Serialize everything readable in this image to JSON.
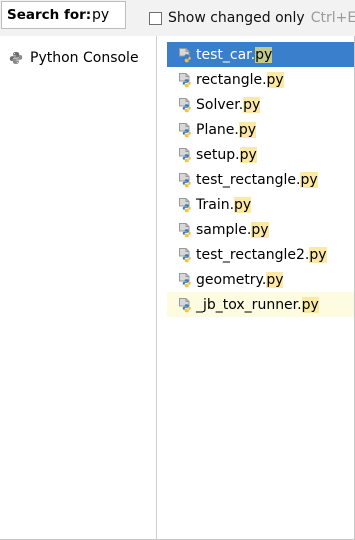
{
  "search": {
    "label": "Search for:",
    "value": "py"
  },
  "show_changed": {
    "label": "Show changed only",
    "shortcut": "Ctrl+E",
    "checked": false
  },
  "left_panel": {
    "items": [
      {
        "label": "Python Console",
        "icon": "python-icon"
      }
    ]
  },
  "files": [
    {
      "stem": "test_car.",
      "match": "py",
      "selected": true
    },
    {
      "stem": "rectangle.",
      "match": "py"
    },
    {
      "stem": "Solver.",
      "match": "py"
    },
    {
      "stem": "Plane.",
      "match": "py"
    },
    {
      "stem": "setup.",
      "match": "py"
    },
    {
      "stem": "test_rectangle.",
      "match": "py"
    },
    {
      "stem": "Train.",
      "match": "py"
    },
    {
      "stem": "sample.",
      "match": "py"
    },
    {
      "stem": "test_rectangle2.",
      "match": "py"
    },
    {
      "stem": "geometry.",
      "match": "py"
    },
    {
      "stem": "_jb_tox_runner.",
      "match": "py",
      "hovered": true
    }
  ],
  "colors": {
    "selection": "#3a7fcc",
    "match_highlight": "#fbe9a5",
    "hover_row": "#fdfbe0"
  }
}
